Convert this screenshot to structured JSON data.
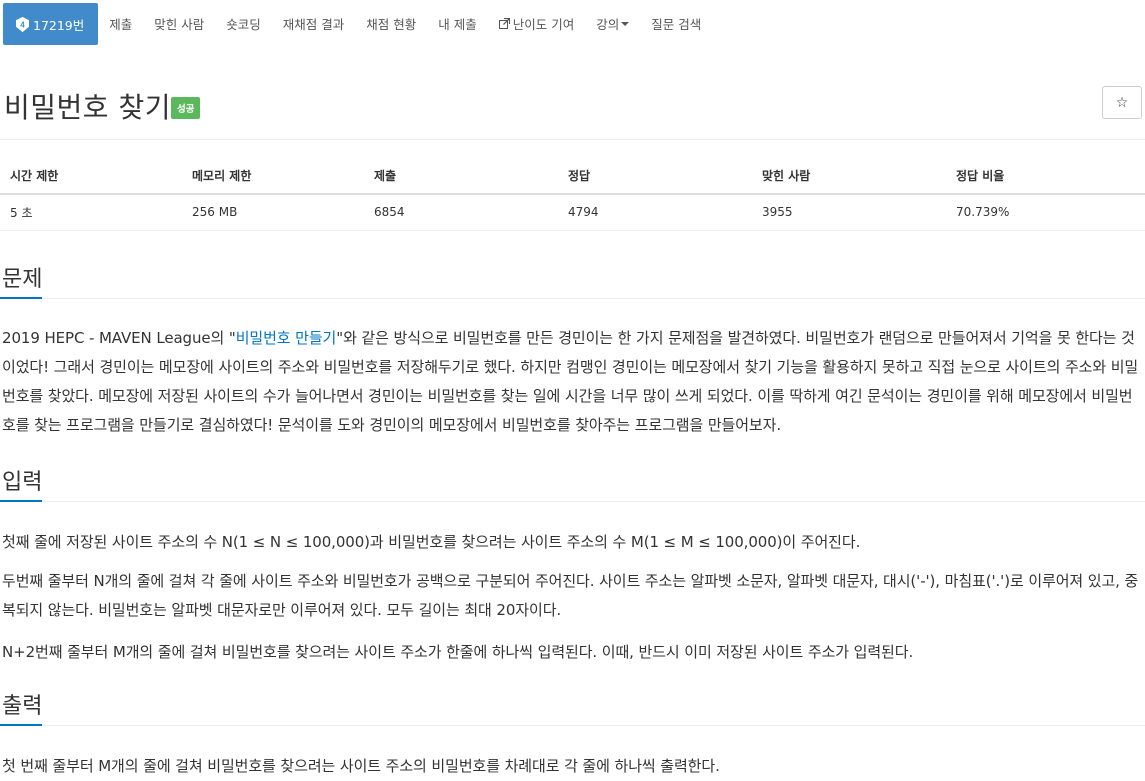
{
  "menu": {
    "problem_id": "17219번",
    "items": [
      "제출",
      "맞힌 사람",
      "숏코딩",
      "재채점 결과",
      "채점 현황",
      "내 제출"
    ],
    "contribute_label": "난이도 기여",
    "lecture_label": "강의",
    "question_search_label": "질문 검색"
  },
  "title": {
    "text": "비밀번호 찾기",
    "status": "성공"
  },
  "info": {
    "headers": [
      "시간 제한",
      "메모리 제한",
      "제출",
      "정답",
      "맞힌 사람",
      "정답 비율"
    ],
    "values": [
      "5 초",
      "256 MB",
      "6854",
      "4794",
      "3955",
      "70.739%"
    ]
  },
  "sections": {
    "problem": {
      "heading": "문제",
      "text_before": "2019 HEPC - MAVEN League의 \"",
      "link": "비밀번호 만들기",
      "text_after": "\"와 같은 방식으로 비밀번호를 만든 경민이는 한 가지 문제점을 발견하였다. 비밀번호가 랜덤으로 만들어져서 기억을 못 한다는 것이었다! 그래서 경민이는 메모장에 사이트의 주소와 비밀번호를 저장해두기로 했다. 하지만 컴맹인 경민이는 메모장에서 찾기 기능을 활용하지 못하고 직접 눈으로 사이트의 주소와 비밀번호를 찾았다. 메모장에 저장된 사이트의 수가 늘어나면서 경민이는 비밀번호를 찾는 일에 시간을 너무 많이 쓰게 되었다. 이를 딱하게 여긴 문석이는 경민이를 위해 메모장에서 비밀번호를 찾는 프로그램을 만들기로 결심하였다! 문석이를 도와 경민이의 메모장에서 비밀번호를 찾아주는 프로그램을 만들어보자."
    },
    "input": {
      "heading": "입력",
      "p1": "첫째 줄에 저장된 사이트 주소의 수 N(1 ≤ N ≤ 100,000)과 비밀번호를 찾으려는 사이트 주소의 수 M(1 ≤ M ≤ 100,000)이 주어진다.",
      "p2": "두번째 줄부터 N개의 줄에 걸쳐 각 줄에 사이트 주소와 비밀번호가 공백으로 구분되어 주어진다. 사이트 주소는 알파벳 소문자, 알파벳 대문자, 대시('-'), 마침표('.')로 이루어져 있고, 중복되지 않는다. 비밀번호는 알파벳 대문자로만 이루어져 있다. 모두 길이는 최대 20자이다.",
      "p3": "N+2번째 줄부터 M개의 줄에 걸쳐 비밀번호를 찾으려는 사이트 주소가 한줄에 하나씩 입력된다. 이때, 반드시 이미 저장된 사이트 주소가 입력된다."
    },
    "output": {
      "heading": "출력",
      "p1": "첫 번째 줄부터 M개의 줄에 걸쳐 비밀번호를 찾으려는 사이트 주소의 비밀번호를 차례대로 각 줄에 하나씩 출력한다."
    }
  },
  "colors": {
    "accent": "#428bca",
    "link": "#0076c0",
    "success": "#5cb85c"
  },
  "icons": {
    "tier": "tier-badge-icon",
    "external": "external-link-icon",
    "star": "star-icon",
    "caret": "caret-down-icon"
  }
}
